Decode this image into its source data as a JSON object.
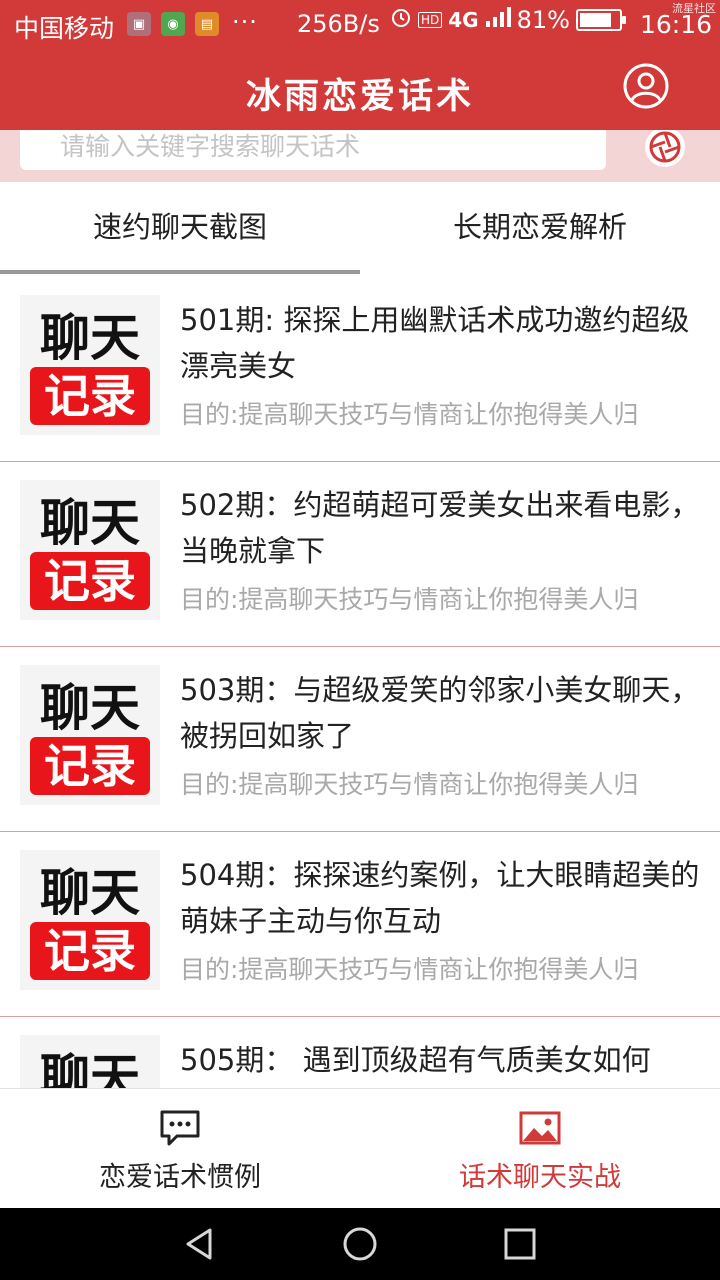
{
  "status_bar": {
    "carrier": "中国移动",
    "ellipsis": "···",
    "network_speed": "256B/s",
    "hd": "HD",
    "network": "4G",
    "battery_percent": "81%",
    "battery_level": 0.81,
    "time": "16:16",
    "watermark": "流星社区"
  },
  "app_bar": {
    "title": "冰雨恋爱话术",
    "profile_icon": "user-circle-icon"
  },
  "search": {
    "placeholder": "请输入关键字搜索聊天话术",
    "camera_icon": "camera-icon"
  },
  "tabs": [
    {
      "label": "速约聊天截图",
      "selected": true
    },
    {
      "label": "长期恋爱解析",
      "selected": false
    }
  ],
  "thumbnail": {
    "top_text": "聊天",
    "bottom_text": "记录"
  },
  "items": [
    {
      "title": "501期: 探探上用幽默话术成功邀约超级漂亮美女",
      "subtitle": "目的:提高聊天技巧与情商让你抱得美人归"
    },
    {
      "title": "502期：约超萌超可爱美女出来看电影，当晚就拿下",
      "subtitle": "目的:提高聊天技巧与情商让你抱得美人归"
    },
    {
      "title": "503期：与超级爱笑的邻家小美女聊天，被拐回如家了",
      "subtitle": "目的:提高聊天技巧与情商让你抱得美人归"
    },
    {
      "title": "504期：探探速约案例，让大眼睛超美的萌妹子主动与你互动",
      "subtitle": "目的:提高聊天技巧与情商让你抱得美人归"
    },
    {
      "title": "505期： 遇到顶级超有气质美女如何",
      "subtitle": ""
    }
  ],
  "bottom_nav": [
    {
      "label": "恋爱话术惯例",
      "icon": "chat-bubble-icon",
      "active": false
    },
    {
      "label": "话术聊天实战",
      "icon": "image-icon",
      "active": true
    }
  ],
  "colors": {
    "primary": "#d23a3a",
    "search_band": "#f3d5d5",
    "subtitle": "#a9a9a9",
    "divider": "#d9a0a0"
  }
}
